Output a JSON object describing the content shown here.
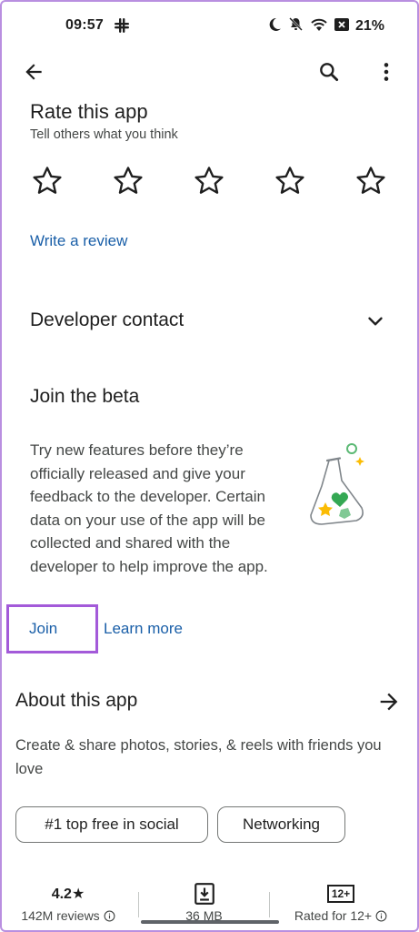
{
  "status": {
    "time": "09:57",
    "battery": "21%"
  },
  "rate": {
    "title": "Rate this app",
    "subtitle": "Tell others what you think",
    "write_review": "Write a review"
  },
  "developer": {
    "title": "Developer contact"
  },
  "beta": {
    "title": "Join the beta",
    "description": "Try new features before they’re officially released and give your feedback to the developer. Certain data on your use of the app will be collected and shared with the developer to help improve the app.",
    "join_label": "Join",
    "learn_more_label": "Learn more"
  },
  "about": {
    "title": "About this app",
    "description": "Create & share photos, stories, & reels with friends you love"
  },
  "chips": [
    {
      "label": "#1 top free in social"
    },
    {
      "label": "Networking"
    }
  ],
  "stats": [
    {
      "top": "4.2★",
      "bottom": "142M reviews"
    },
    {
      "top": "",
      "bottom": "36 MB"
    },
    {
      "top": "",
      "bottom": "Rated for 12+"
    }
  ],
  "rating_badge": "12+",
  "colors": {
    "link": "#1a5fa8",
    "highlight": "#a35ad9",
    "text_primary": "#1f1f1f",
    "text_secondary": "#444746"
  },
  "icons": {
    "back": "arrow-left-icon",
    "search": "search-icon",
    "more": "more-vert-icon",
    "star": "star-outline-icon",
    "chevron": "chevron-down-icon",
    "arrow": "arrow-right-icon",
    "download": "download-icon",
    "info": "info-icon"
  }
}
